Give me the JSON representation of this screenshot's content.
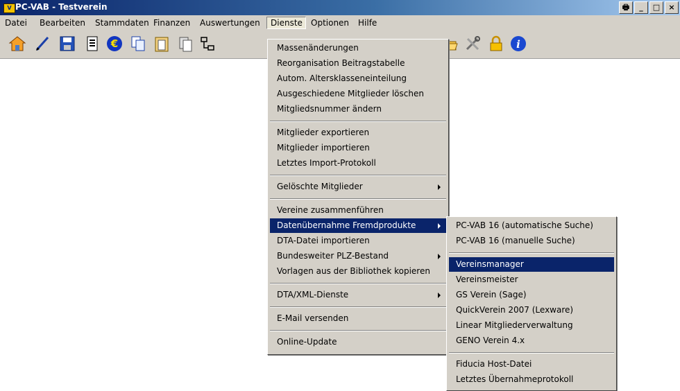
{
  "window": {
    "title": "PC-VAB - Testverein",
    "icon_text": "V",
    "buttons": [
      "🖶",
      "_",
      "□",
      "×"
    ]
  },
  "menubar": [
    "Datei",
    "Bearbeiten",
    "Stammdaten",
    "Finanzen",
    "Auswertungen",
    "Dienste",
    "Optionen",
    "Hilfe"
  ],
  "toolbar": [
    "home-icon",
    "pen-icon",
    "save-icon",
    "document-icon",
    "euro-icon",
    "copy-icon",
    "clipboard-icon",
    "paste-icon",
    "network-icon",
    "folder-icon",
    "tools-icon",
    "lock-icon",
    "info-icon"
  ],
  "dienste_menu": {
    "items": [
      "Massenänderungen",
      "Reorganisation Beitragstabelle",
      "Autom. Altersklasseneinteilung",
      "Ausgeschiedene Mitglieder löschen",
      "Mitgliedsnummer ändern",
      "Mitglieder exportieren",
      "Mitglieder importieren",
      "Letztes Import-Protokoll",
      "Gelöschte Mitglieder",
      "Vereine zusammenführen",
      "Datenübernahme Fremdprodukte",
      "DTA-Datei importieren",
      "Bundesweiter PLZ-Bestand",
      "Vorlagen aus der Bibliothek kopieren",
      "DTA/XML-Dienste",
      "E-Mail versenden",
      "Online-Update"
    ]
  },
  "fremdprodukte_menu": {
    "items": [
      "PC-VAB 16 (automatische Suche)",
      "PC-VAB 16 (manuelle Suche)",
      "Vereinsmanager",
      "Vereinsmeister",
      "GS Verein (Sage)",
      "QuickVerein 2007 (Lexware)",
      "Linear Mitgliederverwaltung",
      "GENO Verein 4.x",
      "Fiducia Host-Datei",
      "Letztes Übernahmeprotokoll"
    ]
  }
}
